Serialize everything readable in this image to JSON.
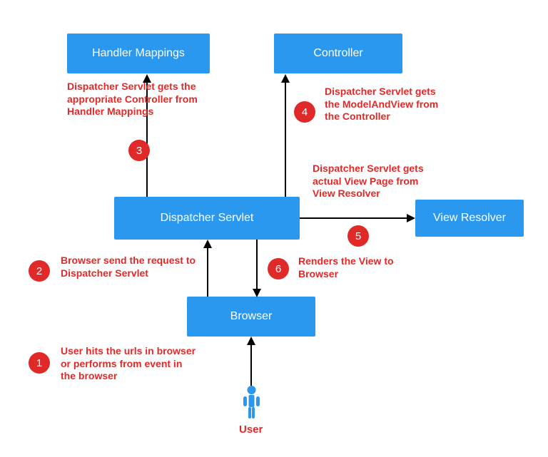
{
  "boxes": {
    "handler_mappings": "Handler Mappings",
    "controller": "Controller",
    "dispatcher_servlet": "Dispatcher Servlet",
    "view_resolver": "View Resolver",
    "browser": "Browser"
  },
  "steps": {
    "s1": {
      "num": "1",
      "text": "User hits the urls in browser or performs from event in the browser"
    },
    "s2": {
      "num": "2",
      "text": "Browser send the request to Dispatcher Servlet"
    },
    "s3": {
      "num": "3",
      "text": "Dispatcher Servlet gets the appropriate Controller from Handler Mappings"
    },
    "s4": {
      "num": "4",
      "text": "Dispatcher Servlet gets the ModelAndView from the Controller"
    },
    "s5": {
      "num": "5",
      "text": "Dispatcher Servlet gets actual View Page from View Resolver"
    },
    "s6": {
      "num": "6",
      "text": "Renders the View to Browser"
    }
  },
  "user_label": "User",
  "colors": {
    "box": "#2b98f0",
    "accent": "#e02a29"
  }
}
